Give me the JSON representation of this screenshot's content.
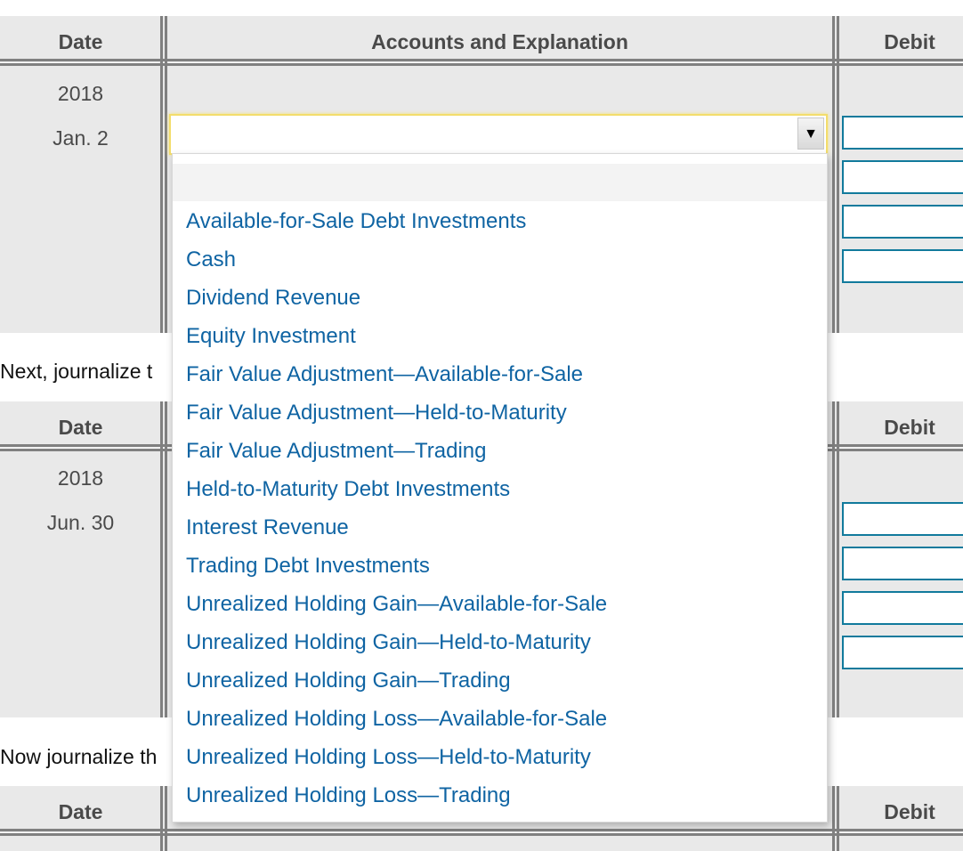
{
  "columns": {
    "date": "Date",
    "accounts": "Accounts and Explanation",
    "debit": "Debit"
  },
  "tables": [
    {
      "year": "2018",
      "date": "Jan. 2",
      "account_selected": "",
      "debit_inputs": [
        "",
        "",
        "",
        ""
      ]
    },
    {
      "year": "2018",
      "date": "Jun. 30",
      "account_selected": "",
      "debit_inputs": [
        "",
        "",
        "",
        ""
      ]
    },
    {
      "year": "",
      "date": ""
    }
  ],
  "instructions": [
    "Next, journalize t",
    "Now journalize th"
  ],
  "dropdown": {
    "arrow_icon": "▼",
    "options": [
      "",
      "Available-for-Sale Debt Investments",
      "Cash",
      "Dividend Revenue",
      "Equity Investment",
      "Fair Value Adjustment—Available-for-Sale",
      "Fair Value Adjustment—Held-to-Maturity",
      "Fair Value Adjustment—Trading",
      "Held-to-Maturity Debt Investments",
      "Interest Revenue",
      "Trading Debt Investments",
      "Unrealized Holding Gain—Available-for-Sale",
      "Unrealized Holding Gain—Held-to-Maturity",
      "Unrealized Holding Gain—Trading",
      "Unrealized Holding Loss—Available-for-Sale",
      "Unrealized Holding Loss—Held-to-Maturity",
      "Unrealized Holding Loss—Trading"
    ]
  },
  "colors": {
    "link_blue": "#0f64a3",
    "input_border": "#117a9c",
    "focus_yellow": "#f3dd6b",
    "table_bg": "#e9e9e9",
    "grid_line": "#808080"
  }
}
